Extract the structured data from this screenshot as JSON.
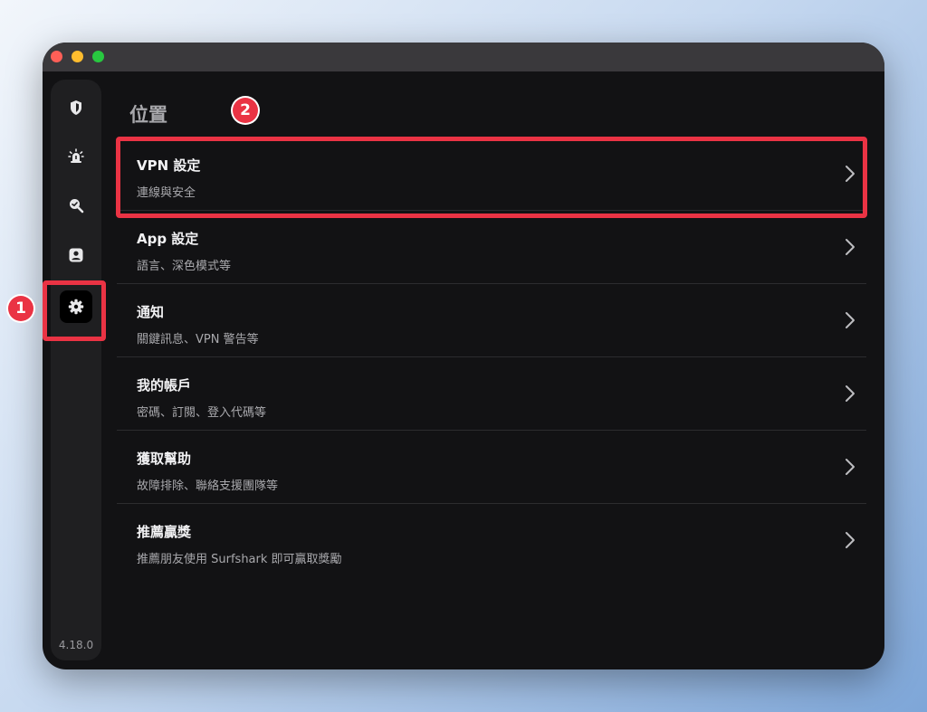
{
  "app": {
    "version": "4.18.0",
    "page_title": "位置"
  },
  "sidebar": {
    "items": [
      {
        "name": "shield-icon"
      },
      {
        "name": "alert-icon"
      },
      {
        "name": "search-icon"
      },
      {
        "name": "account-icon"
      },
      {
        "name": "gear-icon",
        "active": true
      }
    ]
  },
  "menu": {
    "items": [
      {
        "title": "VPN 設定",
        "subtitle": "連線與安全"
      },
      {
        "title": "App 設定",
        "subtitle": "語言、深色模式等"
      },
      {
        "title": "通知",
        "subtitle": "關鍵訊息、VPN 警告等"
      },
      {
        "title": "我的帳戶",
        "subtitle": "密碼、訂閱、登入代碼等"
      },
      {
        "title": "獲取幫助",
        "subtitle": "故障排除、聯絡支援團隊等"
      },
      {
        "title": "推薦贏獎",
        "subtitle": "推薦朋友使用 Surfshark 即可贏取獎勵"
      }
    ]
  },
  "annotations": {
    "step1": "1",
    "step2": "2",
    "color": "#ea3344"
  }
}
